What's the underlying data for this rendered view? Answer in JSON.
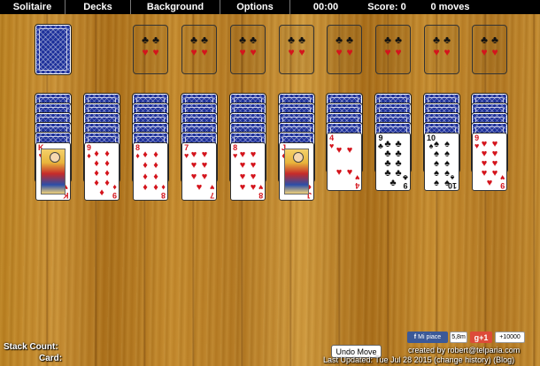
{
  "menu": {
    "items": [
      "Solitaire",
      "Decks",
      "Background",
      "Options"
    ],
    "time": "00:00",
    "score_label": "Score:",
    "score": "0",
    "moves": "0",
    "moves_label": "moves"
  },
  "foundations": [
    {
      "suit": "clubs-hearts",
      "pips": [
        "♣",
        "♥"
      ]
    },
    {
      "suit": "clubs-hearts",
      "pips": [
        "♣",
        "♥"
      ]
    },
    {
      "suit": "clubs-hearts",
      "pips": [
        "♣",
        "♥"
      ]
    },
    {
      "suit": "clubs-hearts",
      "pips": [
        "♣",
        "♥"
      ]
    },
    {
      "suit": "clubs-hearts",
      "pips": [
        "♣",
        "♥"
      ]
    },
    {
      "suit": "clubs-hearts",
      "pips": [
        "♣",
        "♥"
      ]
    },
    {
      "suit": "clubs-hearts",
      "pips": [
        "♣",
        "♥"
      ]
    },
    {
      "suit": "clubs-hearts",
      "pips": [
        "♣",
        "♥"
      ]
    }
  ],
  "tableau": [
    {
      "face_down": 5,
      "card": {
        "rank": "K",
        "suit": "♥",
        "color": "red",
        "pips": 0,
        "court": true
      }
    },
    {
      "face_down": 5,
      "card": {
        "rank": "9",
        "suit": "♦",
        "color": "red",
        "pips": 9
      }
    },
    {
      "face_down": 5,
      "card": {
        "rank": "8",
        "suit": "♦",
        "color": "red",
        "pips": 8
      }
    },
    {
      "face_down": 5,
      "card": {
        "rank": "7",
        "suit": "♥",
        "color": "red",
        "pips": 7
      }
    },
    {
      "face_down": 5,
      "card": {
        "rank": "8",
        "suit": "♥",
        "color": "red",
        "pips": 8
      }
    },
    {
      "face_down": 5,
      "card": {
        "rank": "J",
        "suit": "♦",
        "color": "red",
        "pips": 0,
        "court": true
      }
    },
    {
      "face_down": 4,
      "card": {
        "rank": "4",
        "suit": "♥",
        "color": "red",
        "pips": 4
      }
    },
    {
      "face_down": 4,
      "card": {
        "rank": "9",
        "suit": "♣",
        "color": "blk",
        "pips": 9
      }
    },
    {
      "face_down": 4,
      "card": {
        "rank": "10",
        "suit": "♠",
        "color": "blk",
        "pips": 10
      }
    },
    {
      "face_down": 4,
      "card": {
        "rank": "9",
        "suit": "♥",
        "color": "red",
        "pips": 9
      }
    }
  ],
  "bottom": {
    "stack_count_label": "Stack Count:",
    "card_label": "Card:",
    "undo_label": "Undo Move",
    "like_label": "Mi piace",
    "like_count": "5,8m",
    "gplus_label": "g+1",
    "gplus_count": "+10000",
    "created_by": "created by robert@telparia.com",
    "last_updated": "Last Updated: Tue Jul 28 2015 (change history) (Blog)"
  },
  "colors": {
    "menubar": "#000000",
    "card_back": "#1c2f9a",
    "red_suit": "#d4141c",
    "facebook": "#3b5998",
    "gplus": "#dd4b39"
  }
}
